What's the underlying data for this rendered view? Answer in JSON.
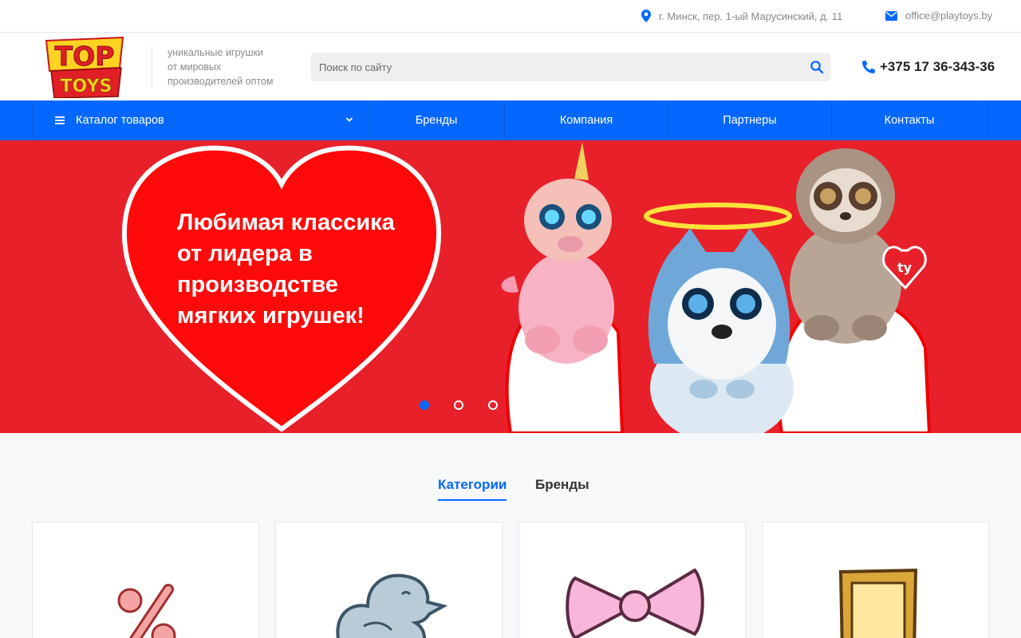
{
  "topbar": {
    "address": "г. Минск, пер. 1-ый Марусинский, д. 11",
    "email": "office@playtoys.by",
    "address_icon": "map-pin-icon",
    "email_icon": "envelope-icon"
  },
  "header": {
    "logo_top": "TOP",
    "logo_bottom": "TOYS",
    "slogan_line1": "уникальные игрушки",
    "slogan_line2": "от мировых",
    "slogan_line3": "производителей оптом",
    "search_placeholder": "Поиск по сайту",
    "phone": "+375 17 36-343-36"
  },
  "nav": {
    "catalog": "Каталог товаров",
    "items": [
      "Бренды",
      "Компания",
      "Партнеры",
      "Контакты"
    ]
  },
  "banner": {
    "line1": "Любимая классика",
    "line2": "от лидера в",
    "line3": "производстве",
    "line4": "мягких игрушек!",
    "tag_text": "ty",
    "slides_total": 3,
    "active_slide": 1
  },
  "tabs": {
    "categories": "Категории",
    "brands": "Бренды",
    "active": "categories"
  },
  "cards": [
    {
      "icon": "percent-icon"
    },
    {
      "icon": "duck-icon"
    },
    {
      "icon": "bow-icon"
    },
    {
      "icon": "frame-icon"
    }
  ],
  "colors": {
    "accent": "#0568fe",
    "banner_red": "#e8202a",
    "heart_red": "#fe0a0a",
    "logo_yellow": "#ffd321",
    "logo_red": "#e01f26"
  }
}
